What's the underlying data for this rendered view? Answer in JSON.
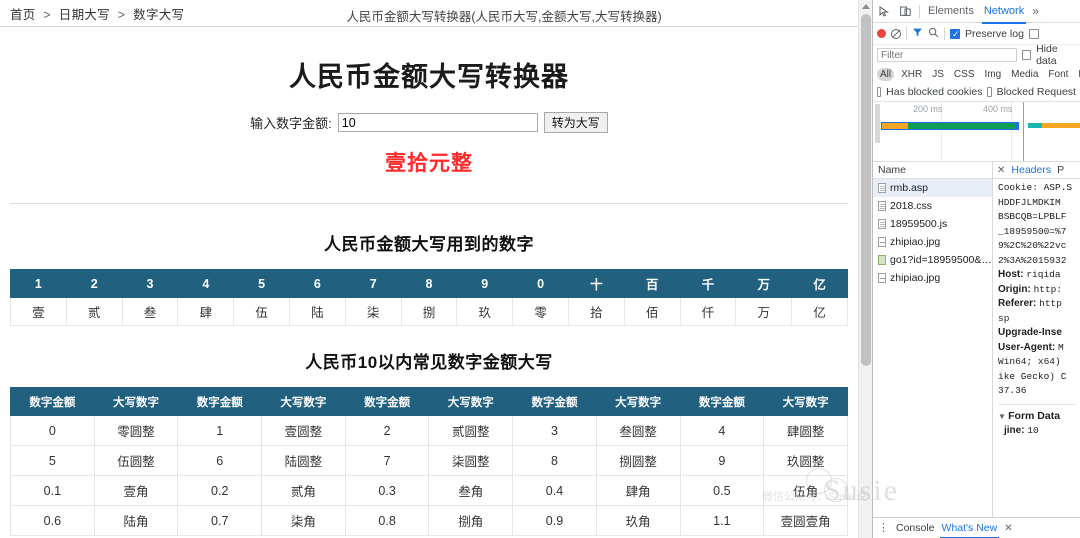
{
  "browser": {
    "doc_title": "人民币金额大写转换器(人民币大写,金额大写,大写转换器)",
    "breadcrumb": [
      {
        "label": "首页"
      },
      {
        "label": "日期大写"
      },
      {
        "label": "数字大写"
      }
    ],
    "breadcrumb_sep": ">"
  },
  "page": {
    "main_title": "人民币金额大写转换器",
    "form": {
      "label": "输入数字金额:",
      "input_value": "10",
      "input_placeholder": "",
      "button_label": "转为大写"
    },
    "result": "壹拾元整",
    "section1": {
      "title": "人民币金额大写用到的数字",
      "headers": [
        "1",
        "2",
        "3",
        "4",
        "5",
        "6",
        "7",
        "8",
        "9",
        "0",
        "十",
        "百",
        "千",
        "万",
        "亿"
      ],
      "values": [
        "壹",
        "贰",
        "叁",
        "肆",
        "伍",
        "陆",
        "柒",
        "捌",
        "玖",
        "零",
        "拾",
        "佰",
        "仟",
        "万",
        "亿"
      ]
    },
    "section2": {
      "title": "人民币10以内常见数字金额大写",
      "headers": [
        "数字金额",
        "大写数字",
        "数字金额",
        "大写数字",
        "数字金额",
        "大写数字",
        "数字金额",
        "大写数字",
        "数字金额",
        "大写数字"
      ],
      "rows": [
        [
          "0",
          "零圆整",
          "1",
          "壹圆整",
          "2",
          "贰圆整",
          "3",
          "叁圆整",
          "4",
          "肆圆整"
        ],
        [
          "5",
          "伍圆整",
          "6",
          "陆圆整",
          "7",
          "柒圆整",
          "8",
          "捌圆整",
          "9",
          "玖圆整"
        ],
        [
          "0.1",
          "壹角",
          "0.2",
          "贰角",
          "0.3",
          "叁角",
          "0.4",
          "肆角",
          "0.5",
          "伍角"
        ],
        [
          "0.6",
          "陆角",
          "0.7",
          "柒角",
          "0.8",
          "捌角",
          "0.9",
          "玖角",
          "1.1",
          "壹圆壹角"
        ]
      ]
    },
    "colors": {
      "table_header_bg": "#21607f",
      "result_red": "#ff2a2a"
    }
  },
  "devtools": {
    "tabbar": {
      "inspect_icon": "cursor-inspect-icon",
      "device_icon": "device-toggle-icon",
      "tabs": [
        {
          "label": "Elements",
          "active": false
        },
        {
          "label": "Network",
          "active": true
        }
      ],
      "overflow": "»"
    },
    "toolbar": {
      "record_icon": "record-icon",
      "clear_icon": "clear-icon",
      "filter_icon": "filter-funnel-icon",
      "search_icon": "search-icon",
      "preserve_log": {
        "label": "Preserve log",
        "checked": true
      },
      "disable_cache": {
        "label": "",
        "checked": false
      }
    },
    "filter": {
      "placeholder": "Filter",
      "value": "",
      "hide_data_urls": {
        "label": "Hide data",
        "checked": false
      },
      "types": [
        {
          "label": "All",
          "active": true
        },
        {
          "label": "XHR",
          "active": false
        },
        {
          "label": "JS",
          "active": false
        },
        {
          "label": "CSS",
          "active": false
        },
        {
          "label": "Img",
          "active": false
        },
        {
          "label": "Media",
          "active": false
        },
        {
          "label": "Font",
          "active": false
        },
        {
          "label": "Doc",
          "active": false
        }
      ],
      "has_blocked_cookies": {
        "label": "Has blocked cookies",
        "checked": false
      },
      "blocked_requests": {
        "label": "Blocked Request",
        "checked": false
      }
    },
    "overview": {
      "ticks": [
        "200 ms",
        "400 ms"
      ],
      "bars": [
        {
          "color": "#f5a623"
        },
        {
          "color": "#0f9d58"
        },
        {
          "color": "#1a73e8"
        },
        {
          "color": "#19b5b0"
        },
        {
          "color": "#f5a623"
        }
      ]
    },
    "requests": {
      "column_header": "Name",
      "rows": [
        {
          "name": "rmb.asp",
          "icon": "document-icon",
          "selected": true
        },
        {
          "name": "2018.css",
          "icon": "stylesheet-icon",
          "selected": false
        },
        {
          "name": "18959500.js",
          "icon": "script-icon",
          "selected": false
        },
        {
          "name": "zhipiao.jpg",
          "icon": "image-icon",
          "selected": false
        },
        {
          "name": "go1?id=18959500&…",
          "icon": "image-icon",
          "selected": false
        },
        {
          "name": "zhipiao.jpg",
          "icon": "image-icon",
          "selected": false
        }
      ]
    },
    "details": {
      "close_icon": "close-icon",
      "tabs": [
        {
          "label": "Headers",
          "active": true
        },
        {
          "label": "P",
          "active": false
        }
      ],
      "lines": [
        "Cookie: ASP.S",
        "HDDFJLMDKIM",
        "BSBCQB=LPBLF",
        "_18959500=%7",
        "9%2C%20%22vc",
        "2%3A%2015932"
      ],
      "headers": [
        {
          "key": "Host:",
          "value": "riqida"
        },
        {
          "key": "Origin:",
          "value": "http:"
        },
        {
          "key": "Referer:",
          "value": "http"
        },
        {
          "key": "",
          "value": "sp"
        },
        {
          "key": "Upgrade-Inse",
          "value": ""
        },
        {
          "key": "User-Agent:",
          "value": "M"
        },
        {
          "key": "",
          "value": "Win64; x64)"
        },
        {
          "key": "",
          "value": "ike Gecko) C"
        },
        {
          "key": "",
          "value": "37.36"
        }
      ],
      "form_data": {
        "caret": "▼",
        "title": "Form Data",
        "entries": [
          {
            "key": "jine:",
            "value": "10"
          }
        ]
      }
    },
    "drawer": {
      "kebab_icon": "more-options-icon",
      "tabs": [
        {
          "label": "Console",
          "active": false
        },
        {
          "label": "What's New",
          "active": true
        }
      ],
      "close_icon": "close-icon"
    }
  },
  "watermark": {
    "text": "Susie",
    "sub": "微信公众号：Susie说"
  }
}
